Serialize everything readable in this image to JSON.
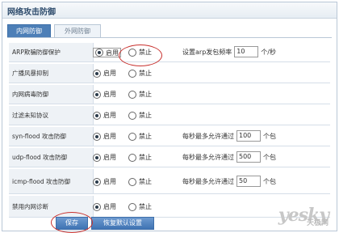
{
  "header": {
    "title": "网络攻击防御"
  },
  "tabs": [
    {
      "label": "内网防御"
    },
    {
      "label": "外网防御"
    }
  ],
  "rows": [
    {
      "label": "ARP欺骗防御保护",
      "enable": "启用",
      "disable": "禁止",
      "selected": "enable",
      "extra": {
        "prefix": "设置arp发包频率",
        "value": "10",
        "suffix": "个/秒"
      }
    },
    {
      "label": "广播风暴抑制",
      "enable": "启用",
      "disable": "禁止",
      "selected": "enable"
    },
    {
      "label": "内网病毒防御",
      "enable": "启用",
      "disable": "禁止",
      "selected": "enable"
    },
    {
      "label": "过滤未知协议",
      "enable": "启用",
      "disable": "禁止",
      "selected": "enable"
    },
    {
      "label": "syn-flood 攻击防御",
      "enable": "启用",
      "disable": "禁止",
      "selected": "enable",
      "extra": {
        "prefix": "每秒最多允许通过",
        "value": "100",
        "suffix": "个包"
      }
    },
    {
      "label": "udp-flood 攻击防御",
      "enable": "启用",
      "disable": "禁止",
      "selected": "enable",
      "extra": {
        "prefix": "每秒最多允许通过",
        "value": "500",
        "suffix": "个包"
      }
    },
    {
      "label": "icmp-flood 攻击防御",
      "enable": "启用",
      "disable": "禁止",
      "selected": "enable",
      "extra": {
        "prefix": "每秒最多允许通过",
        "value": "50",
        "suffix": "个包"
      }
    },
    {
      "label": "禁用内网诊断",
      "enable": "启用",
      "disable": "禁止",
      "selected": "enable"
    }
  ],
  "buttons": {
    "save": "保存",
    "reset": "恢复默认设置"
  },
  "watermark": {
    "main": "yesky",
    "sub": "天极网"
  },
  "colors": {
    "accent": "#4d7fb7",
    "highlight": "#c8312e"
  }
}
